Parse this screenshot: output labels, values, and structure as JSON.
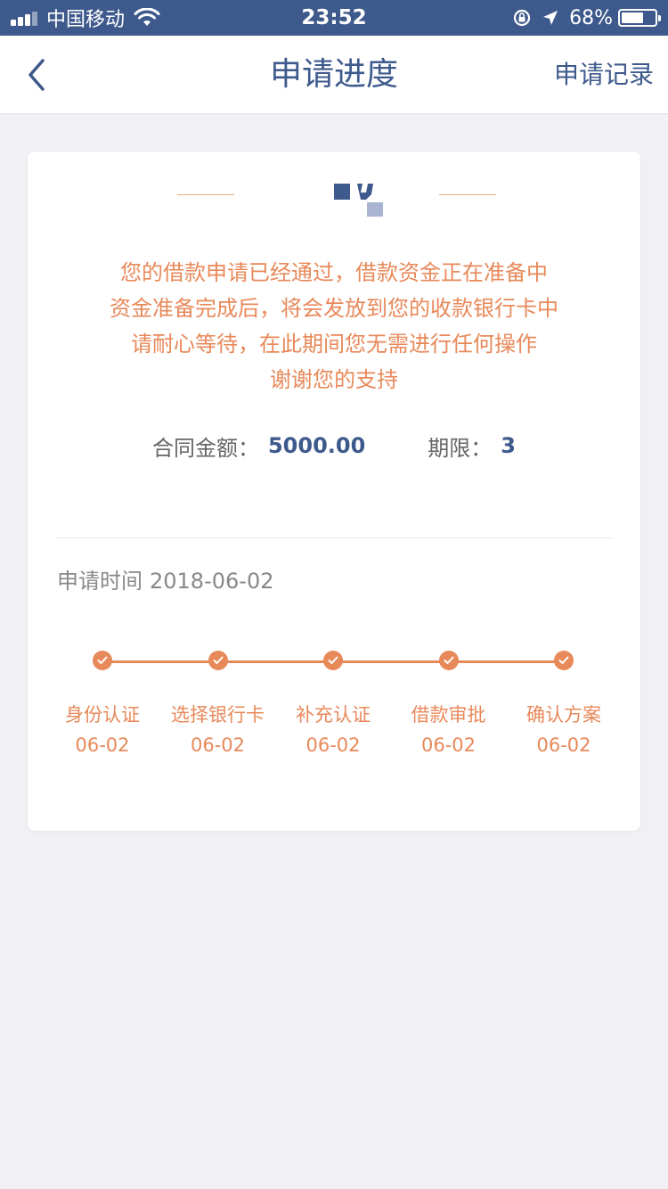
{
  "status_bar": {
    "carrier": "中国移动",
    "time": "23:52",
    "battery": "68%",
    "battery_level": 0.68,
    "icons": [
      "signal-icon",
      "wifi-icon",
      "orientation-lock-icon",
      "location-icon",
      "battery-icon"
    ]
  },
  "nav": {
    "back_icon": "chevron-left-icon",
    "title": "申请进度",
    "right_label": "申请记录"
  },
  "card": {
    "notice_lines": [
      "您的借款申请已经通过，借款资金正在准备中",
      "资金准备完成后，将会发放到您的收款银行卡中",
      "请耐心等待，在此期间您无需进行任何操作",
      "谢谢您的支持"
    ],
    "contract_amount_label": "合同金额：",
    "contract_amount": "5000.00",
    "term_label": "期限：",
    "term": "3",
    "apply_time_label": "申请时间",
    "apply_time": "2018-06-02",
    "steps": [
      {
        "name": "身份认证",
        "date": "06-02"
      },
      {
        "name": "选择银行卡",
        "date": "06-02"
      },
      {
        "name": "补充认证",
        "date": "06-02"
      },
      {
        "name": "借款审批",
        "date": "06-02"
      },
      {
        "name": "确认方案",
        "date": "06-02"
      }
    ]
  },
  "colors": {
    "brand_blue": "#3e5a8c",
    "accent_orange": "#e8895a",
    "background": "#f0f0f5"
  }
}
